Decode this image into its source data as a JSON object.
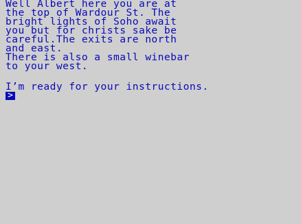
{
  "game": {
    "narrative": [
      "Well Albert here you are at",
      "the top of Wardour St. The",
      "bright lights of Soho await",
      "you but for christs sake be",
      "careful.The exits are north",
      "and east.",
      "There is also a small winebar",
      "to your west."
    ],
    "prompt": "I’m ready for your instructions.",
    "cursor_glyph": ">"
  },
  "colors": {
    "background": "#cfcfcf",
    "text": "#0a0ab8",
    "cursor_fg": "#ffffff"
  }
}
